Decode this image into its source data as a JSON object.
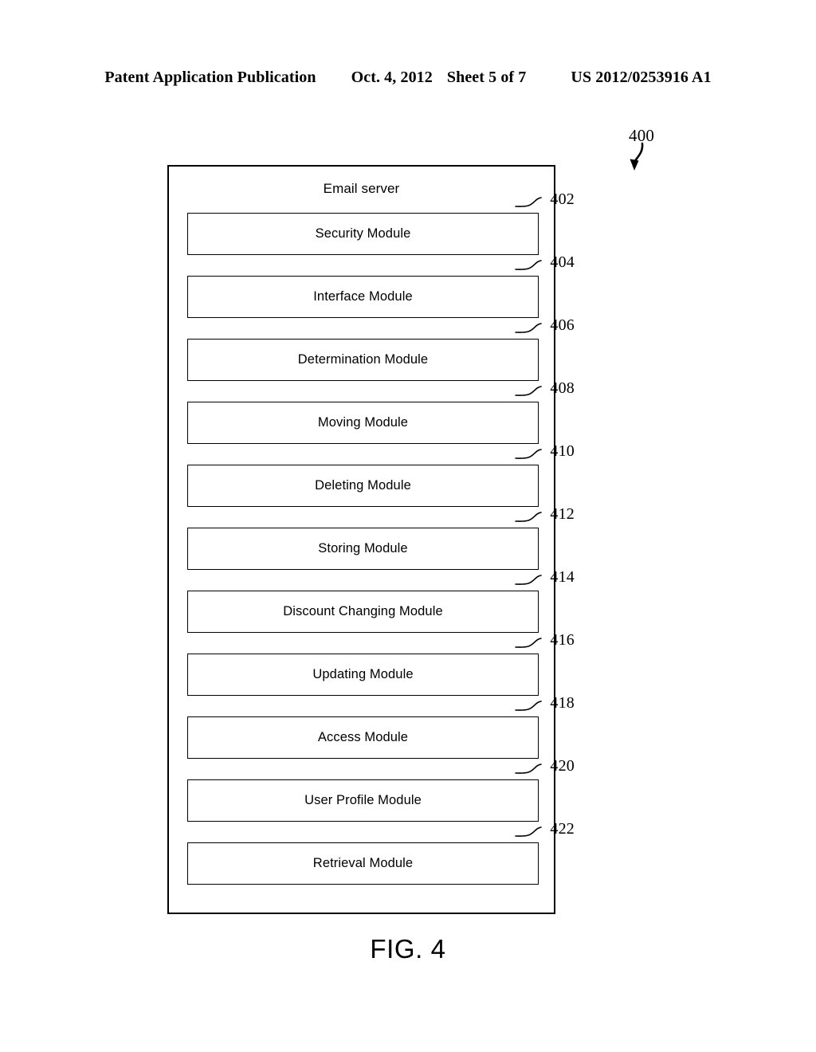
{
  "header": {
    "publication": "Patent Application Publication",
    "date": "Oct. 4, 2012",
    "sheet": "Sheet 5 of 7",
    "document_number": "US 2012/0253916 A1"
  },
  "figure": {
    "reference_number": "400",
    "caption": "FIG. 4"
  },
  "server": {
    "title": "Email server",
    "modules": [
      {
        "label": "Security Module",
        "ref": "402"
      },
      {
        "label": "Interface Module",
        "ref": "404"
      },
      {
        "label": "Determination Module",
        "ref": "406"
      },
      {
        "label": "Moving Module",
        "ref": "408"
      },
      {
        "label": "Deleting Module",
        "ref": "410"
      },
      {
        "label": "Storing Module",
        "ref": "412"
      },
      {
        "label": "Discount Changing Module",
        "ref": "414"
      },
      {
        "label": "Updating Module",
        "ref": "416"
      },
      {
        "label": "Access Module",
        "ref": "418"
      },
      {
        "label": "User Profile Module",
        "ref": "420"
      },
      {
        "label": "Retrieval Module",
        "ref": "422"
      }
    ]
  },
  "colors": {
    "ink": "#000000",
    "paper": "#ffffff"
  }
}
